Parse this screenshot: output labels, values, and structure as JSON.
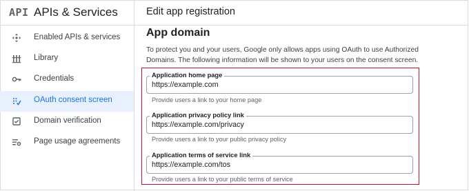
{
  "sidebar": {
    "logo": "API",
    "title": "APIs & Services",
    "items": [
      {
        "label": "Enabled APIs & services",
        "icon": "diamond-arrows-icon",
        "active": false
      },
      {
        "label": "Library",
        "icon": "library-icon",
        "active": false
      },
      {
        "label": "Credentials",
        "icon": "key-icon",
        "active": false
      },
      {
        "label": "OAuth consent screen",
        "icon": "consent-icon",
        "active": true
      },
      {
        "label": "Domain verification",
        "icon": "checkbox-icon",
        "active": false
      },
      {
        "label": "Page usage agreements",
        "icon": "settings-list-icon",
        "active": false
      }
    ]
  },
  "header": {
    "title": "Edit app registration"
  },
  "main": {
    "section_title": "App domain",
    "description": "To protect you and your users, Google only allows apps using OAuth to use Authorized Domains. The following information will be shown to your users on the consent screen.",
    "fields": [
      {
        "label": "Application home page",
        "value": "https://example.com",
        "hint": "Provide users a link to your home page"
      },
      {
        "label": "Application privacy policy link",
        "value": "https://example.com/privacy",
        "hint": "Provide users a link to your public privacy policy"
      },
      {
        "label": "Application terms of service link",
        "value": "https://example.com/tos",
        "hint": "Provide users a link to your public terms of service"
      }
    ]
  },
  "colors": {
    "accent": "#1a73e8",
    "active_bg": "#e8f0fe",
    "highlight_border": "#c8102e"
  }
}
